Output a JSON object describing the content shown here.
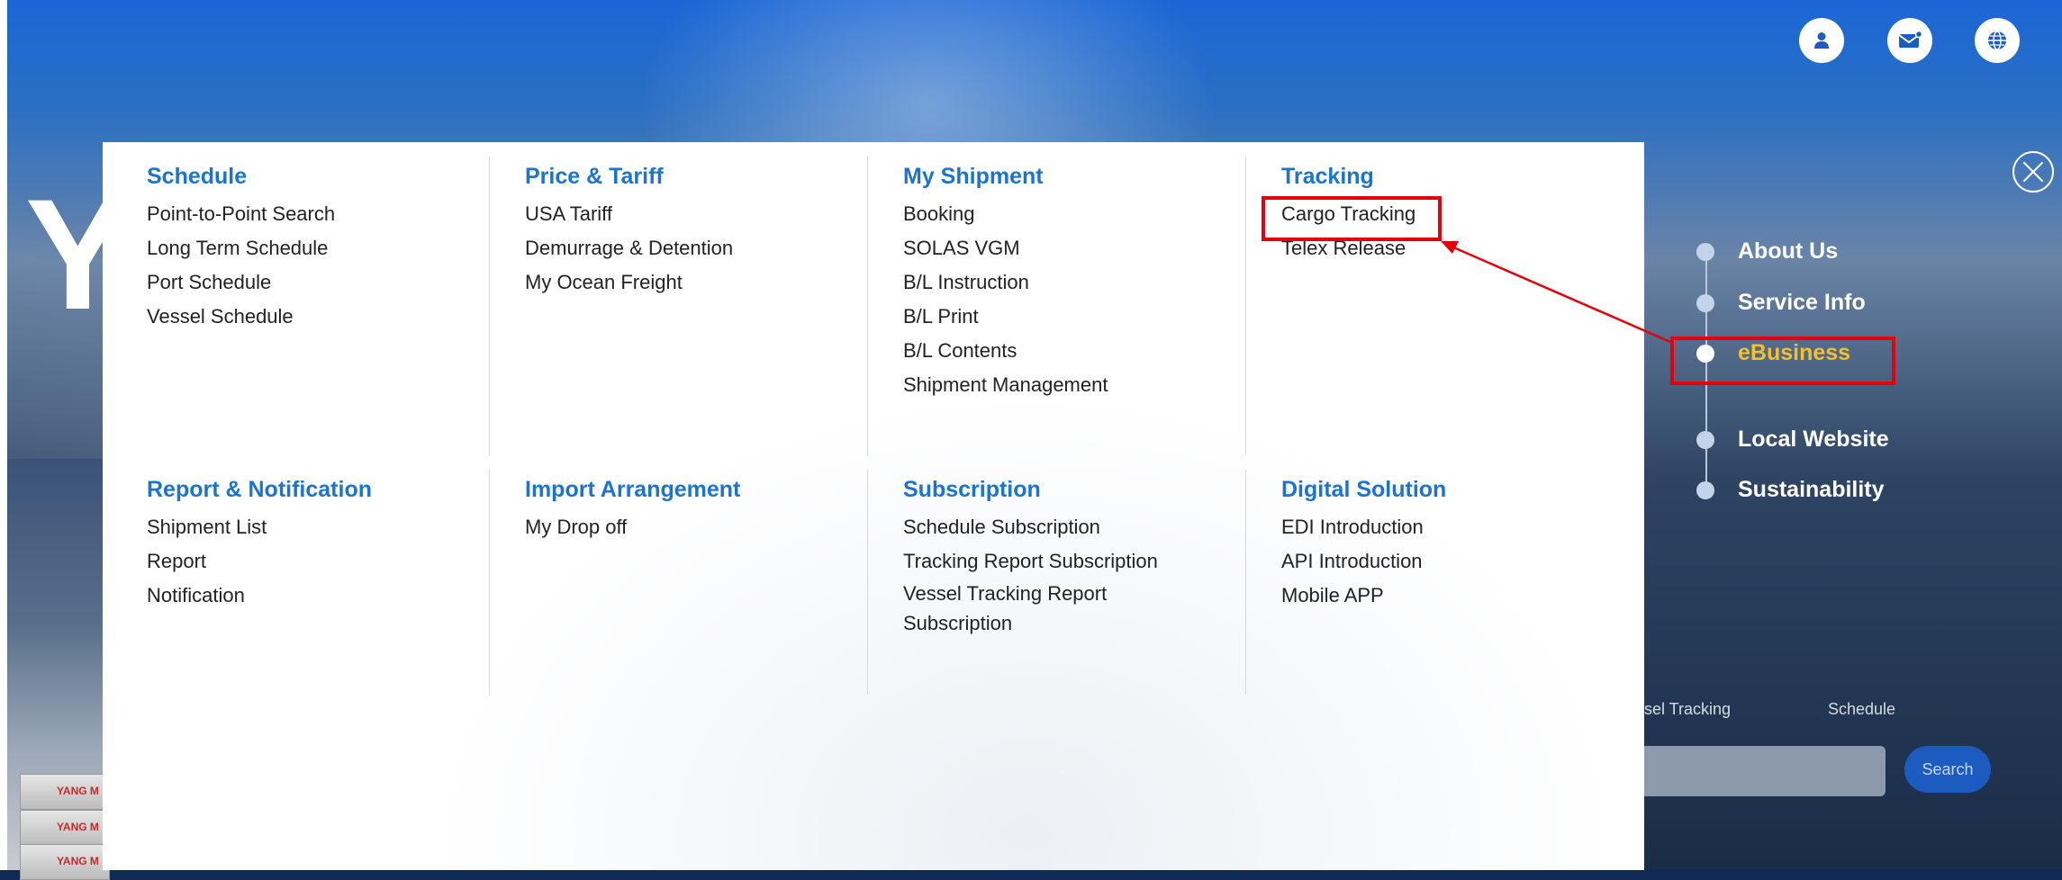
{
  "menu": {
    "sections": [
      {
        "title": "Schedule",
        "items": [
          "Point-to-Point Search",
          "Long Term Schedule",
          "Port Schedule",
          "Vessel Schedule"
        ]
      },
      {
        "title": "Price & Tariff",
        "items": [
          "USA Tariff",
          "Demurrage & Detention",
          "My Ocean Freight"
        ]
      },
      {
        "title": "My Shipment",
        "items": [
          "Booking",
          "SOLAS VGM",
          "B/L Instruction",
          "B/L Print",
          "B/L Contents",
          "Shipment Management"
        ]
      },
      {
        "title": "Tracking",
        "items": [
          "Cargo Tracking",
          "Telex Release"
        ]
      },
      {
        "title": "Report & Notification",
        "items": [
          "Shipment List",
          "Report",
          "Notification"
        ]
      },
      {
        "title": "Import Arrangement",
        "items": [
          "My Drop off"
        ]
      },
      {
        "title": "Subscription",
        "items": [
          "Schedule Subscription",
          "Tracking Report Subscription",
          "Vessel Tracking Report Subscription"
        ]
      },
      {
        "title": "Digital Solution",
        "items": [
          "EDI Introduction",
          "API Introduction",
          "Mobile APP"
        ]
      }
    ]
  },
  "side_nav": {
    "items": [
      "About Us",
      "Service Info",
      "eBusiness",
      "Local Website",
      "Sustainability"
    ],
    "active": "eBusiness"
  },
  "hero": {
    "letter": "Y"
  },
  "container_brand": "YANG M",
  "search": {
    "tab_vessel_partial": "sel Tracking",
    "tab_schedule": "Schedule",
    "button_label": "Search"
  },
  "colors": {
    "section_title": "#1a74d0",
    "active_nav": "#f5bf2a",
    "highlight": "#e5000a"
  },
  "icons": [
    "user-icon",
    "mail-icon",
    "globe-icon",
    "close-icon"
  ]
}
